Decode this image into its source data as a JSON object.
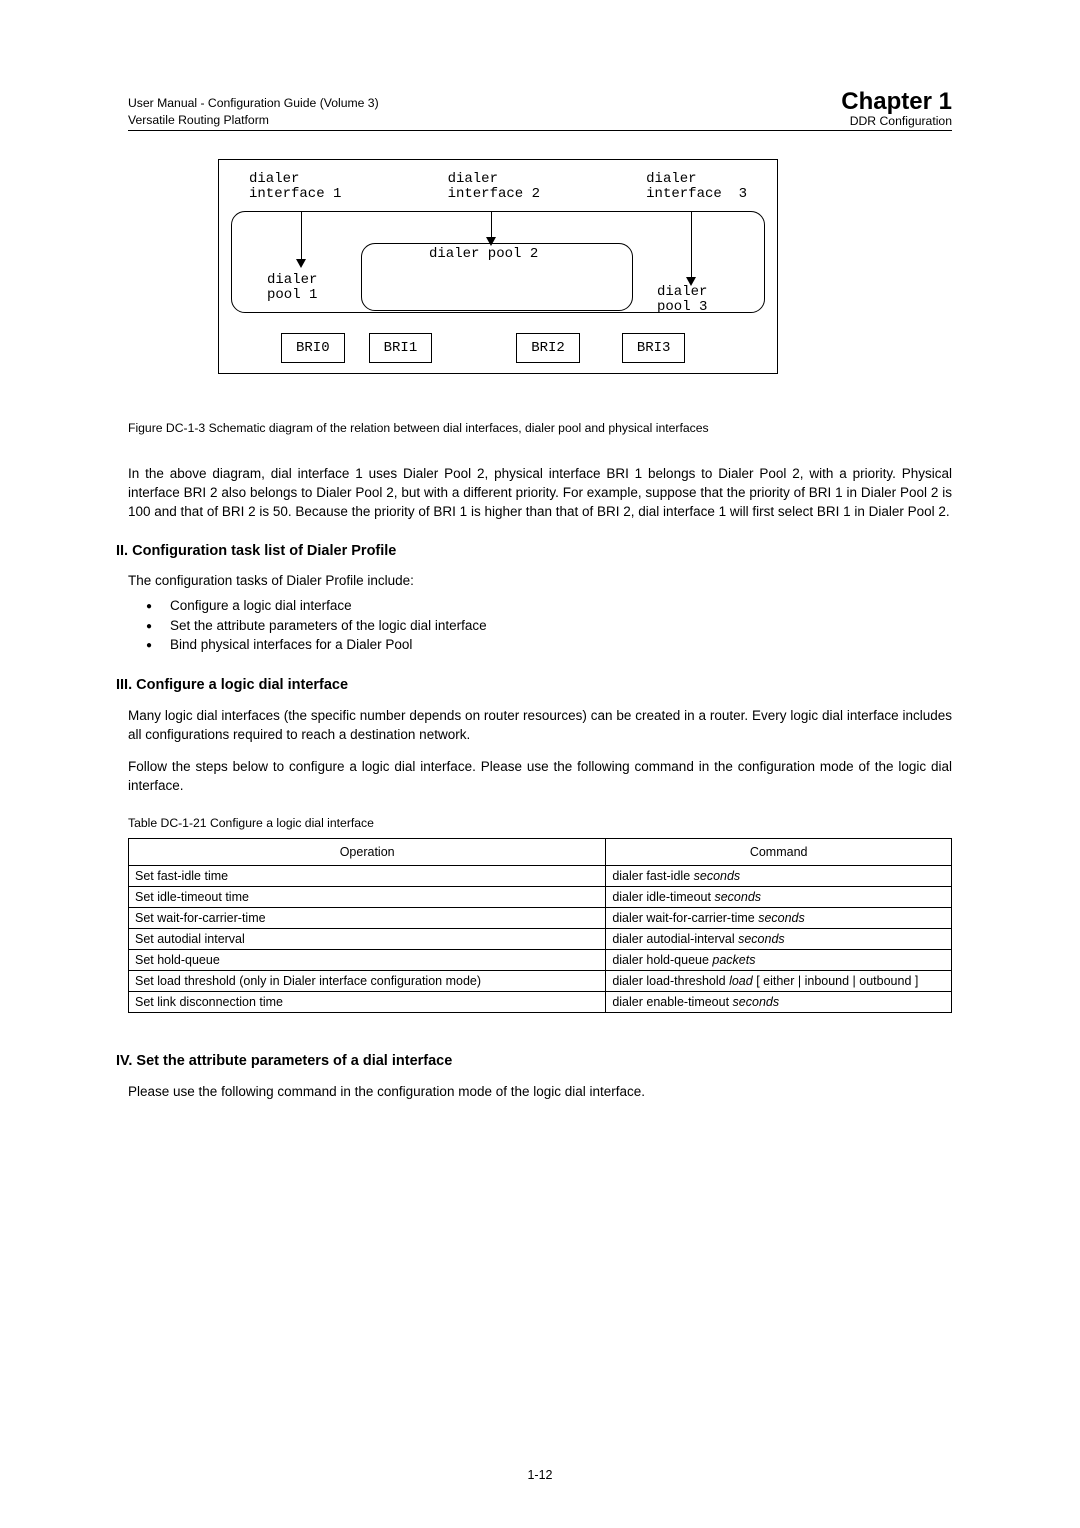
{
  "header": {
    "left_line1": "User Manual - Configuration Guide (Volume 3)",
    "left_line2": "Versatile Routing Platform",
    "chapter": "Chapter 1",
    "sub": "DDR Configuration"
  },
  "diagram": {
    "iface1": "dialer\ninterface 1",
    "iface2": "dialer\ninterface 2",
    "iface3": "dialer\ninterface  3",
    "pool1": "dialer\npool 1",
    "pool2": "dialer pool 2",
    "pool3": "dialer\npool 3",
    "bri": [
      "BRI0",
      "BRI1",
      "BRI2",
      "BRI3"
    ]
  },
  "figure": {
    "label": "Figure DC-1-3",
    "desc": "  Schematic diagram of the relation between dial interfaces, dialer pool and physical interfaces"
  },
  "paragraphs": {
    "p_above": "In the above diagram, dial interface 1 uses Dialer Pool 2, physical interface BRI 1 belongs to Dialer Pool 2, with a priority. Physical interface BRI 2 also belongs to Dialer Pool 2, but with a different priority. For example, suppose that the priority of BRI 1 in Dialer Pool 2 is 100 and that of BRI 2 is 50. Because the priority of BRI 1 is higher than that of BRI 2, dial interface 1 will first select BRI 1 in Dialer Pool 2.",
    "p_many": "Many logic dial interfaces (the specific number depends on router resources) can be created in a router. Every logic dial interface includes all configurations required to reach a destination network.",
    "p_follow": "Follow the steps below to configure a logic dial interface. Please use the following command in the configuration mode of the logic dial interface.",
    "p_please": "Please use the following command in the configuration mode of the logic dial interface."
  },
  "sections": {
    "s2": "II. Configuration task list of Dialer Profile",
    "s3": "III. Configure a logic dial interface",
    "s4": "IV. Set the attribute parameters of a dial interface"
  },
  "list_intro": "The configuration tasks of Dialer Profile include:",
  "bullets": [
    "Configure a logic dial interface",
    "Set the attribute parameters of the logic dial interface",
    "Bind physical interfaces for a Dialer Pool"
  ],
  "table_caption": {
    "label": "Table DC-1-21",
    "desc": "  Configure a logic dial interface"
  },
  "table": {
    "headers": [
      "Operation",
      "Command"
    ],
    "rows": [
      {
        "op": "Set fast-idle time",
        "cmd": "dialer fast-idle ",
        "param": "seconds"
      },
      {
        "op": "Set idle-timeout time",
        "cmd": "dialer idle-timeout ",
        "param": "seconds"
      },
      {
        "op": "Set wait-for-carrier-time",
        "cmd": "dialer wait-for-carrier-time ",
        "param": "seconds"
      },
      {
        "op": "Set autodial interval",
        "cmd": "dialer autodial-interval ",
        "param": "seconds"
      },
      {
        "op": "Set hold-queue",
        "cmd": "dialer hold-queue ",
        "param": "packets"
      },
      {
        "op": "Set load threshold (only in Dialer interface configuration mode)",
        "cmd_html": "dialer load-threshold <i>load</i> [ either | inbound | outbound ]"
      },
      {
        "op": "Set link disconnection time",
        "cmd": "dialer enable-timeout ",
        "param": "seconds"
      }
    ]
  },
  "page_number": "1-12"
}
